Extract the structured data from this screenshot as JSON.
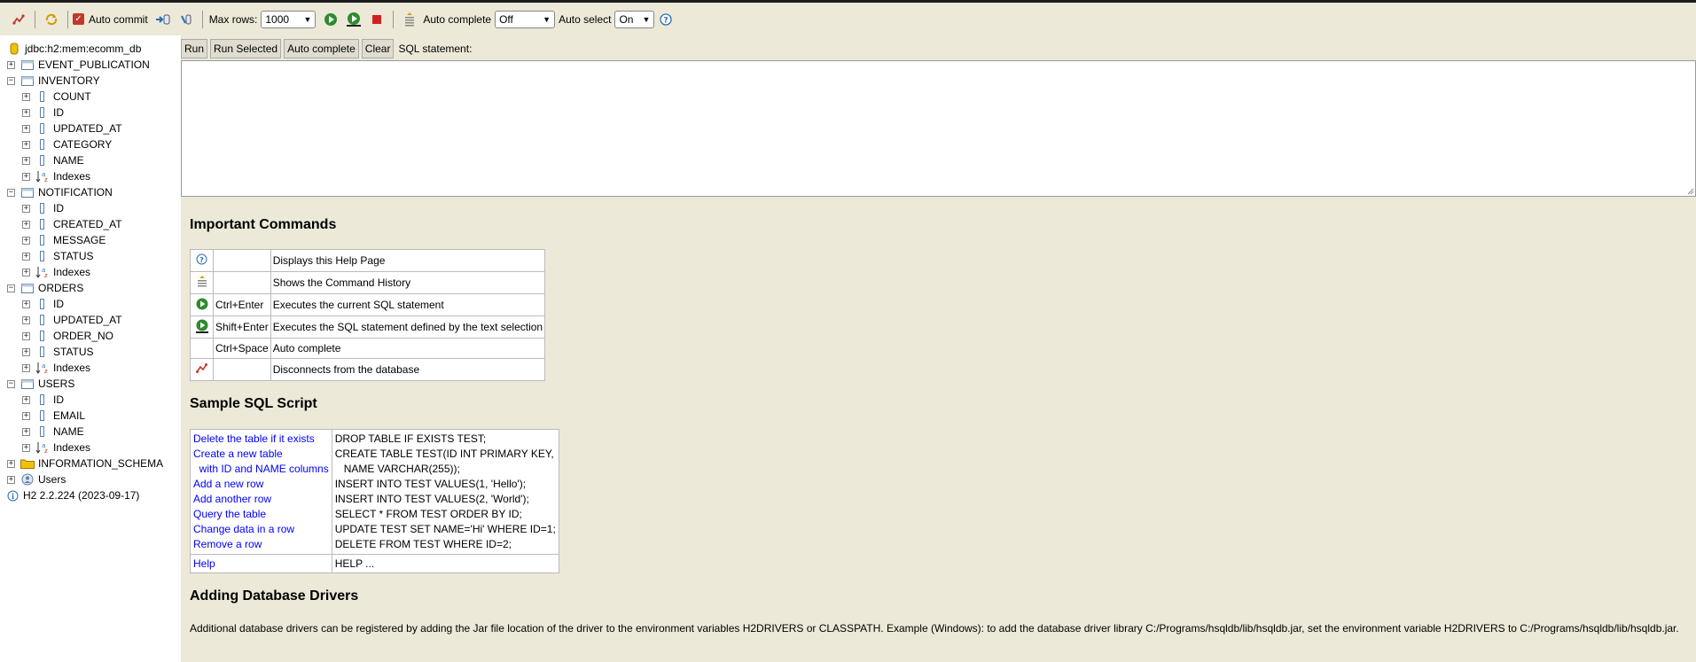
{
  "toolbar": {
    "auto_commit_label": "Auto commit",
    "max_rows_label": "Max rows:",
    "max_rows_value": "1000",
    "auto_complete_label": "Auto complete",
    "auto_complete_value": "Off",
    "auto_select_label": "Auto select",
    "auto_select_value": "On"
  },
  "tree": {
    "connection": "jdbc:h2:mem:ecomm_db",
    "event_publication": "EVENT_PUBLICATION",
    "inventory": "INVENTORY",
    "inventory_cols": [
      "COUNT",
      "ID",
      "UPDATED_AT",
      "CATEGORY",
      "NAME",
      "Indexes"
    ],
    "notification": "NOTIFICATION",
    "notification_cols": [
      "ID",
      "CREATED_AT",
      "MESSAGE",
      "STATUS",
      "Indexes"
    ],
    "orders": "ORDERS",
    "orders_cols": [
      "ID",
      "UPDATED_AT",
      "ORDER_NO",
      "STATUS",
      "Indexes"
    ],
    "users": "USERS",
    "users_cols": [
      "ID",
      "EMAIL",
      "NAME",
      "Indexes"
    ],
    "information_schema": "INFORMATION_SCHEMA",
    "users_node": "Users",
    "version": "H2 2.2.224 (2023-09-17)"
  },
  "editor": {
    "run": "Run",
    "run_selected": "Run Selected",
    "auto_complete": "Auto complete",
    "clear": "Clear",
    "sql_label": "SQL statement:"
  },
  "help": {
    "important_title": "Important Commands",
    "commands": [
      {
        "icon": "help-icon",
        "key": "",
        "desc": "Displays this Help Page"
      },
      {
        "icon": "history-icon",
        "key": "",
        "desc": "Shows the Command History"
      },
      {
        "icon": "run-icon",
        "key": "Ctrl+Enter",
        "desc": "Executes the current SQL statement"
      },
      {
        "icon": "run-selected-icon",
        "key": "Shift+Enter",
        "desc": "Executes the SQL statement defined by the text selection"
      },
      {
        "icon": "",
        "key": "Ctrl+Space",
        "desc": "Auto complete"
      },
      {
        "icon": "disconnect-icon",
        "key": "",
        "desc": "Disconnects from the database"
      }
    ],
    "sample_title": "Sample SQL Script",
    "samples": [
      {
        "link": "Delete the table if it exists",
        "sql": "DROP TABLE IF EXISTS TEST;"
      },
      {
        "link": "Create a new table",
        "sql": "CREATE TABLE TEST(ID INT PRIMARY KEY,"
      },
      {
        "link": "  with ID and NAME columns",
        "sql": "   NAME VARCHAR(255));"
      },
      {
        "link": "Add a new row",
        "sql": "INSERT INTO TEST VALUES(1, 'Hello');"
      },
      {
        "link": "Add another row",
        "sql": "INSERT INTO TEST VALUES(2, 'World');"
      },
      {
        "link": "Query the table",
        "sql": "SELECT * FROM TEST ORDER BY ID;"
      },
      {
        "link": "Change data in a row",
        "sql": "UPDATE TEST SET NAME='Hi' WHERE ID=1;"
      },
      {
        "link": "Remove a row",
        "sql": "DELETE FROM TEST WHERE ID=2;"
      }
    ],
    "help_link": "Help",
    "help_sql": "HELP ...",
    "drivers_title": "Adding Database Drivers",
    "drivers_text": "Additional database drivers can be registered by adding the Jar file location of the driver to the environment variables H2DRIVERS or CLASSPATH. Example (Windows): to add the database driver library C:/Programs/hsqldb/lib/hsqldb.jar, set the environment variable H2DRIVERS to C:/Programs/hsqldb/lib/hsqldb.jar."
  },
  "colors": {
    "panel_bg": "#ece9d8",
    "link": "#0000ff",
    "run_green": "#2e8b2e",
    "stop_red": "#d22020"
  }
}
